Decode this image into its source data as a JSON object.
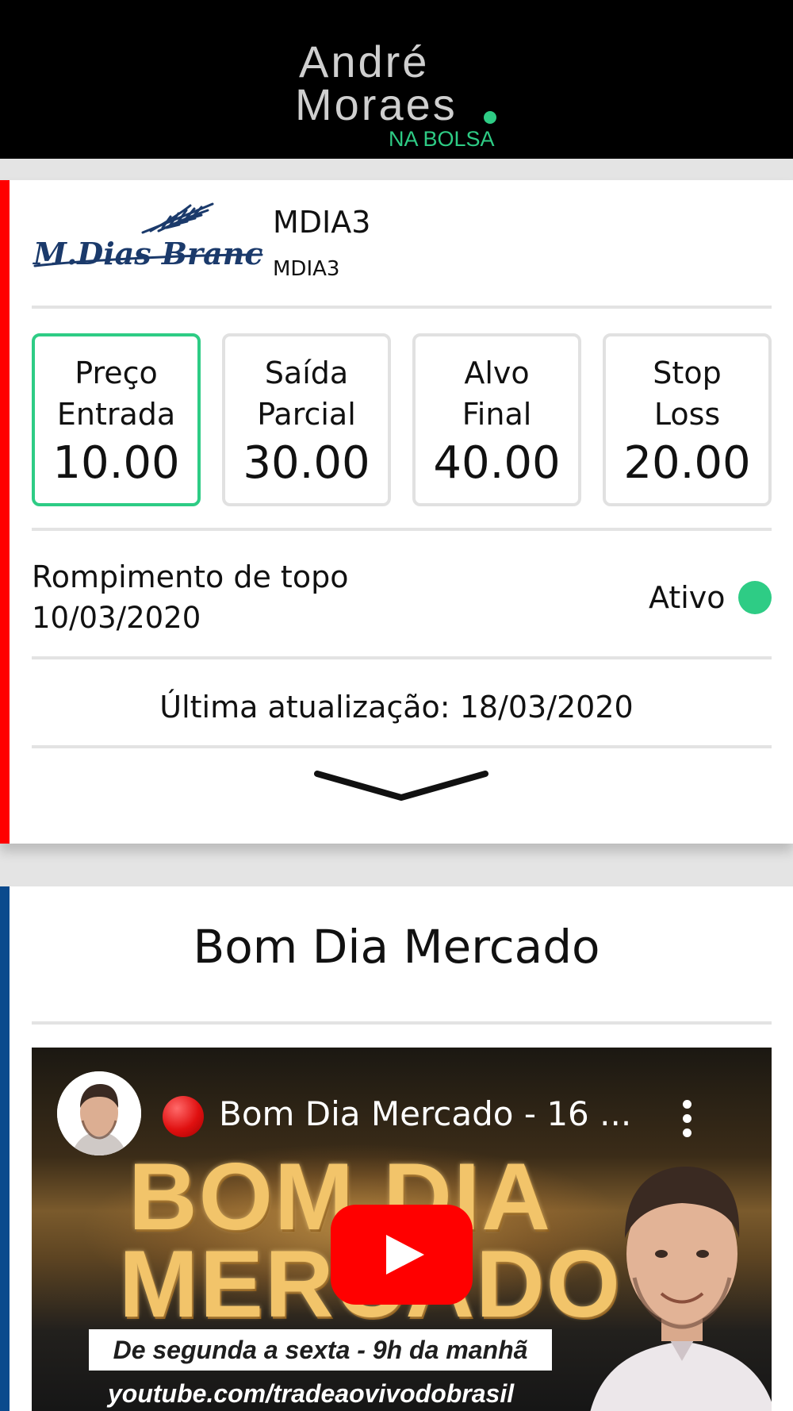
{
  "header": {
    "brand_line1": "André",
    "brand_line2": "Moraes",
    "brand_sub": "NA BOLSA",
    "accent_color": "#2ecc85"
  },
  "ticker_card": {
    "company_logo_text": "M.Dias Branco",
    "ticker": "MDIA3",
    "ticker_sub": "MDIA3",
    "prices": [
      {
        "label": "Preço\nEntrada",
        "value": "10.00",
        "active": true
      },
      {
        "label": "Saída\nParcial",
        "value": "30.00",
        "active": false
      },
      {
        "label": "Alvo\nFinal",
        "value": "40.00",
        "active": false
      },
      {
        "label": "Stop\nLoss",
        "value": "20.00",
        "active": false
      }
    ],
    "setup_name": "Rompimento de topo",
    "setup_date": "10/03/2020",
    "status": "Ativo",
    "status_color": "#2ecc85",
    "last_update": "Última atualização: 18/03/2020",
    "side_color": "#ff0000",
    "expand_icon": "chevron-down-icon"
  },
  "video_card": {
    "section_title": "Bom Dia Mercado",
    "side_color": "#0b4a8d",
    "video": {
      "title": "Bom Dia Mercado - 16 ...",
      "thumb_line1": "BOM DIA",
      "thumb_line2": "MERCADO",
      "banner": "De segunda a sexta - 9h da manhã",
      "url": "youtube.com/tradeaovivodobrasil",
      "play_icon": "youtube-play-icon",
      "menu_icon": "more-vert-icon"
    }
  }
}
